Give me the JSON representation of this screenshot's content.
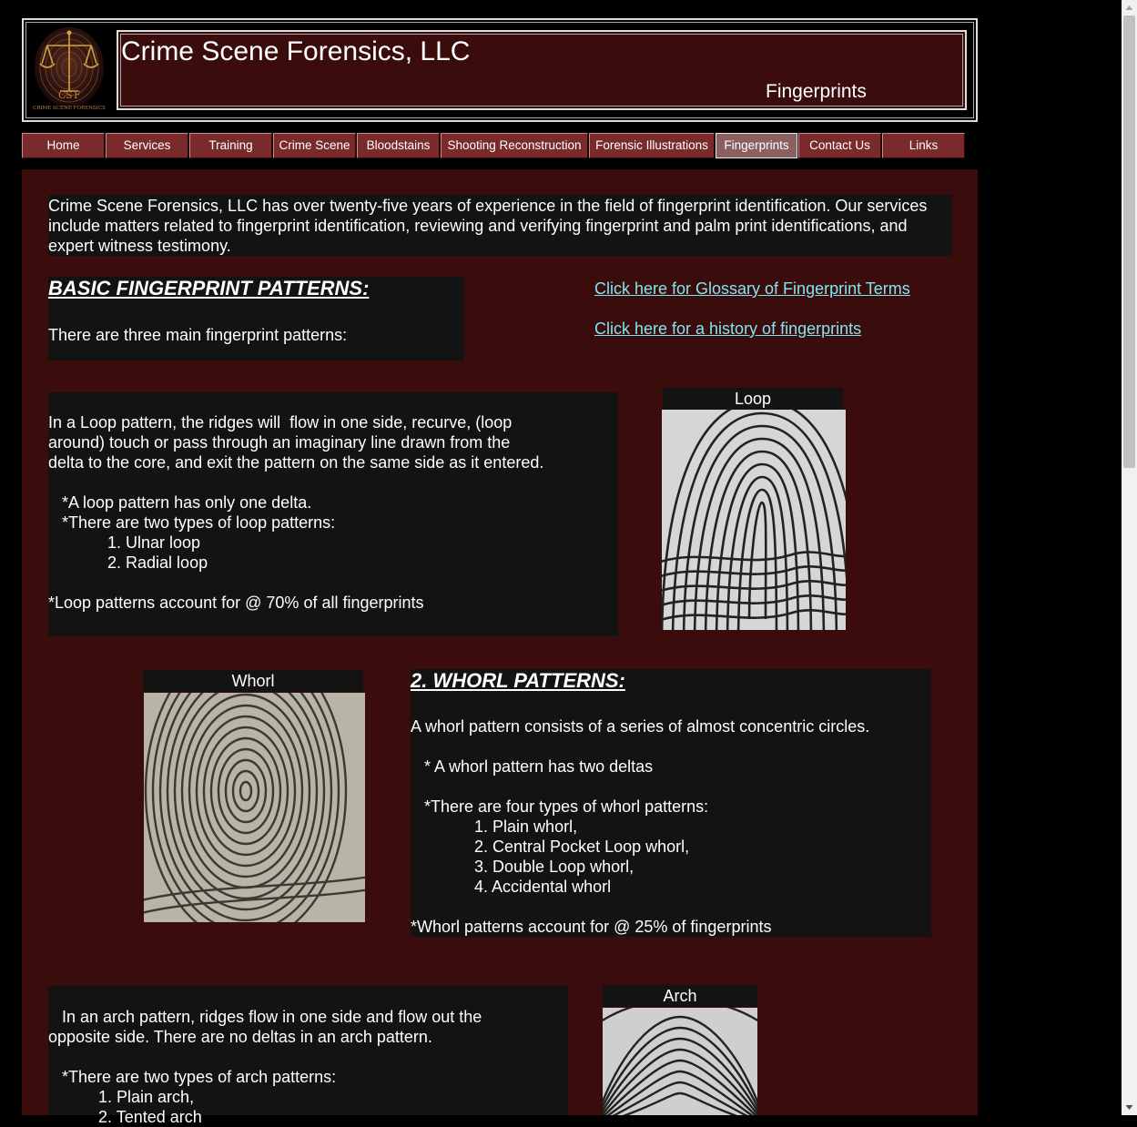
{
  "header": {
    "site_title": "Crime Scene Forensics, LLC",
    "page_subtitle": "Fingerprints",
    "logo_text": "CRIME SCENE FORENSICS"
  },
  "nav": {
    "items": [
      {
        "label": "Home"
      },
      {
        "label": "Services"
      },
      {
        "label": "Training"
      },
      {
        "label": "Crime Scene"
      },
      {
        "label": "Bloodstains"
      },
      {
        "label": "Shooting Reconstruction"
      },
      {
        "label": "Forensic Illustrations"
      },
      {
        "label": "Fingerprints",
        "active": true
      },
      {
        "label": "Contact Us"
      },
      {
        "label": "Links"
      }
    ]
  },
  "intro": {
    "text": "Crime Scene Forensics, LLC has over twenty-five years of experience in the field of fingerprint identification. Our services\ninclude matters related to fingerprint identification, reviewing and verifying fingerprint and palm print identifications, and\nexpert witness testimony."
  },
  "basic": {
    "heading": "BASIC FINGERPRINT PATTERNS:",
    "text": "There are three main fingerprint patterns:"
  },
  "links": {
    "glossary": "Click here for Glossary of Fingerprint Terms",
    "history": "Click here for a history of fingerprints"
  },
  "loop": {
    "caption": "Loop",
    "text": "In a Loop pattern, the ridges will  flow in one side, recurve, (loop\naround) touch or pass through an imaginary line drawn from the\ndelta to the core, and exit the pattern on the same side as it entered.\n\n   *A loop pattern has only one delta.\n   *There are two types of loop patterns:\n             1. Ulnar loop\n             2. Radial loop\n\n*Loop patterns account for @ 70% of all fingerprints"
  },
  "whorl": {
    "caption": "Whorl",
    "heading": "2. WHORL PATTERNS:",
    "text": "A whorl pattern consists of a series of almost concentric circles.\n\n   * A whorl pattern has two deltas\n\n   *There are four types of whorl patterns:\n              1. Plain whorl,\n              2. Central Pocket Loop whorl,\n              3. Double Loop whorl,\n              4. Accidental whorl\n\n*Whorl patterns account for @ 25% of fingerprints"
  },
  "arch": {
    "caption": "Arch",
    "text": "   In an arch pattern, ridges flow in one side and flow out the\nopposite side. There are no deltas in an arch pattern.\n\n   *There are two types of arch patterns:\n           1. Plain arch,\n           2. Tented arch"
  },
  "colors": {
    "page_bg": "#000000",
    "content_bg": "#3a0c0c",
    "panel_bg": "#131313",
    "nav_bg": "#7a2a2a",
    "link": "#7fe6f0"
  },
  "icons": {
    "logo": "scales-of-justice-fingerprint-icon",
    "scroll_up": "triangle-up-icon",
    "scroll_down": "triangle-down-icon"
  }
}
